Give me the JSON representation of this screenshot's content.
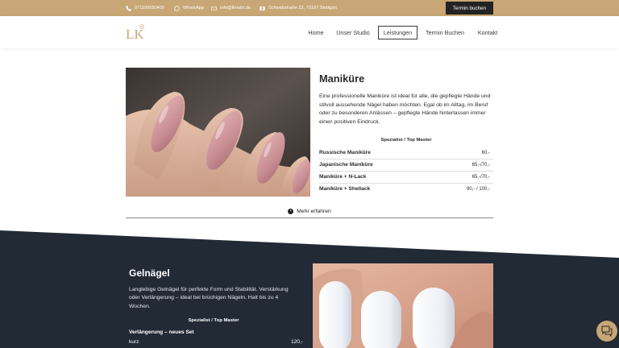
{
  "topbar": {
    "phone": "071199550405",
    "whatsapp": "WhatsApp",
    "email": "info@lknails.de",
    "address": "Schwabstraße 22, 70197 Stuttgart",
    "book_button": "Termin buchen"
  },
  "nav": {
    "logo_text": "LK",
    "items": [
      "Home",
      "Unser Studio",
      "Leistungen",
      "Termin Buchen",
      "Kontakt"
    ],
    "active": "Leistungen"
  },
  "manikuere": {
    "title": "Maniküre",
    "description": "Eine professionelle Maniküre ist ideal für alle, die gepflegte Hände und stilvoll aussehende Nägel haben möchten. Egal ob im Alltag, im Beruf oder zu besonderen Anlässen – gepflegte Hände hinterlassen immer einen positiven Eindruck.",
    "spec_header": "Spezialist / Top Master",
    "prices": [
      {
        "name": "Russische Maniküre",
        "price": "60,-"
      },
      {
        "name": "Japanische Maniküre",
        "price": "65,-/70,-"
      },
      {
        "name": "Maniküre + N-Lack",
        "price": "65,-/70,-"
      },
      {
        "name": "Maniküre + Shellack",
        "price": "90,- / 100,-"
      }
    ],
    "more_label": "Mehr erfahren"
  },
  "gelnaegel": {
    "title": "Gelnägel",
    "description": "Langlebige Gelnägel für perfekte Form und Stabilität. Verstärkung oder Verlängerung – ideal bei brüchigen Nägeln. Halt bis zu 4 Wochen.",
    "spec_header": "Spezialist / Top Master",
    "sub_heading": "Verlängerung – neues Set",
    "rows": [
      {
        "name": "kurz",
        "price": "120,-"
      }
    ]
  },
  "colors": {
    "accent": "#c8a675",
    "dark": "#222a36",
    "nav_text": "#3b3b3b"
  },
  "icons": [
    "phone-icon",
    "whatsapp-icon",
    "mail-icon",
    "map-icon",
    "info-circle-icon",
    "chat-icon"
  ]
}
